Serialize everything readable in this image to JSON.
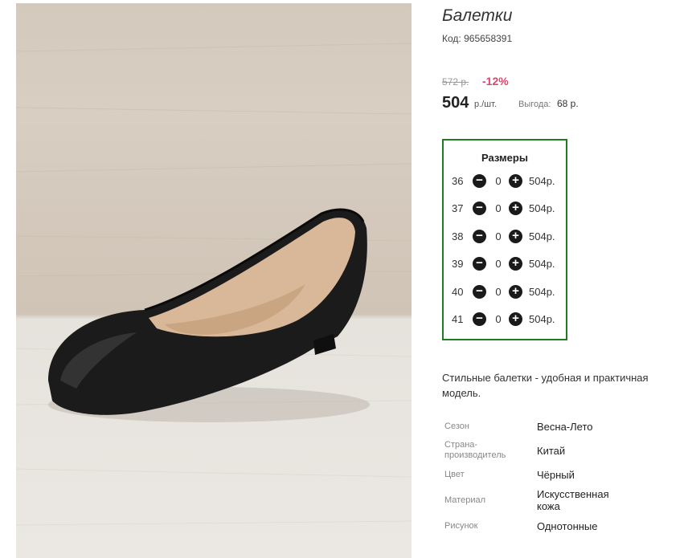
{
  "product": {
    "title": "Балетки",
    "code_label": "Код:",
    "code_value": "965658391",
    "old_price": "572 р.",
    "discount": "-12%",
    "price": "504",
    "unit": "р./шт.",
    "benefit_label": "Выгода:",
    "benefit_value": "68 р.",
    "image_alt": "black ballet flat shoe photo"
  },
  "sizes": {
    "title": "Размеры",
    "rows": [
      {
        "size": "36",
        "qty": "0",
        "price": "504р."
      },
      {
        "size": "37",
        "qty": "0",
        "price": "504р."
      },
      {
        "size": "38",
        "qty": "0",
        "price": "504р."
      },
      {
        "size": "39",
        "qty": "0",
        "price": "504р."
      },
      {
        "size": "40",
        "qty": "0",
        "price": "504р."
      },
      {
        "size": "41",
        "qty": "0",
        "price": "504р."
      }
    ],
    "minus_icon": "minus-circle-icon",
    "plus_icon": "plus-circle-icon",
    "border_color": "#1f7d1f"
  },
  "description": "Стильные балетки - удобная и практичная модель.",
  "properties": [
    {
      "label": "Сезон",
      "value": "Весна-Лето"
    },
    {
      "label": "Страна-производитель",
      "value": "Китай"
    },
    {
      "label": "Цвет",
      "value": "Чёрный"
    },
    {
      "label": "Материал",
      "value": "Искусственная кожа"
    },
    {
      "label": "Рисунок",
      "value": "Однотонные"
    }
  ],
  "colors": {
    "discount": "#e0436b",
    "accent_border": "#1f7d1f"
  }
}
